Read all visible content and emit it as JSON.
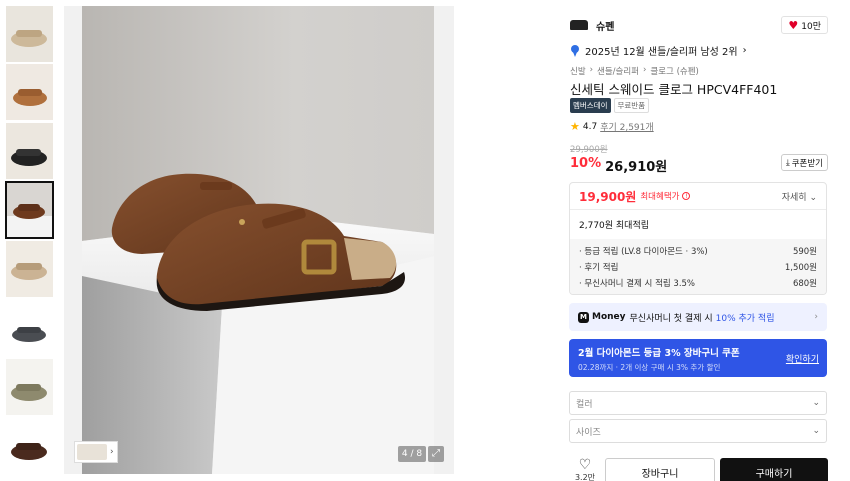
{
  "gallery": {
    "thumbnails": [
      {
        "name": "thumb-1",
        "selected": false
      },
      {
        "name": "thumb-2",
        "selected": false
      },
      {
        "name": "thumb-3",
        "selected": false
      },
      {
        "name": "thumb-4",
        "selected": true
      },
      {
        "name": "thumb-5",
        "selected": false
      },
      {
        "name": "thumb-6",
        "selected": false
      },
      {
        "name": "thumb-7",
        "selected": false
      },
      {
        "name": "thumb-8",
        "selected": false
      }
    ],
    "counter": "4 / 8",
    "expand_icon": "expand-icon"
  },
  "product": {
    "brand_name": "슈펜",
    "like_count": "10만",
    "rank": "2025년 12월 샌들/슬리퍼 남성 2위",
    "breadcrumb": [
      "신발",
      "샌들/슬리퍼",
      "클로그 (슈펜)"
    ],
    "title": "신세틱 스웨이드 클로그 HPCV4FF401",
    "badges": {
      "member_day": "멤버스데이",
      "free_return": "무료반품"
    },
    "rating": "4.7",
    "reviews": "후기 2,591개",
    "original_price": "29,900원",
    "discount": "10%",
    "price": "26,910원",
    "coupon_label": "쿠폰받기"
  },
  "benefits": {
    "max_price": "19,900원",
    "max_label": "최대혜택가",
    "detail": "자세히",
    "accum_total": "2,770원 최대적립",
    "items": [
      {
        "label": "· 등급 적립 (LV.8 다이아몬드 · 3%)",
        "value": "590원"
      },
      {
        "label": "· 후기 적립",
        "value": "1,500원"
      },
      {
        "label": "· 무신사머니 결제 시 적립 3.5%",
        "value": "680원"
      }
    ]
  },
  "money": {
    "logo": "M",
    "name": "Money",
    "text_before": "무신사머니 첫 결제 시",
    "accent": "10% 추가 적립"
  },
  "promo": {
    "title": "2월 다이아몬드 등급 3% 장바구니 쿠폰",
    "subtitle": "02.28까지 · 2개 이상 구매 시 3% 추가 할인",
    "button": "확인하기"
  },
  "options": {
    "color_placeholder": "컬러",
    "size_placeholder": "사이즈"
  },
  "actions": {
    "like_count": "3.2만",
    "cart": "장바구니",
    "buy": "구매하기"
  },
  "colors": {
    "accent_red": "#ff2d3a",
    "accent_blue": "#2f55e6",
    "dark": "#111111"
  }
}
